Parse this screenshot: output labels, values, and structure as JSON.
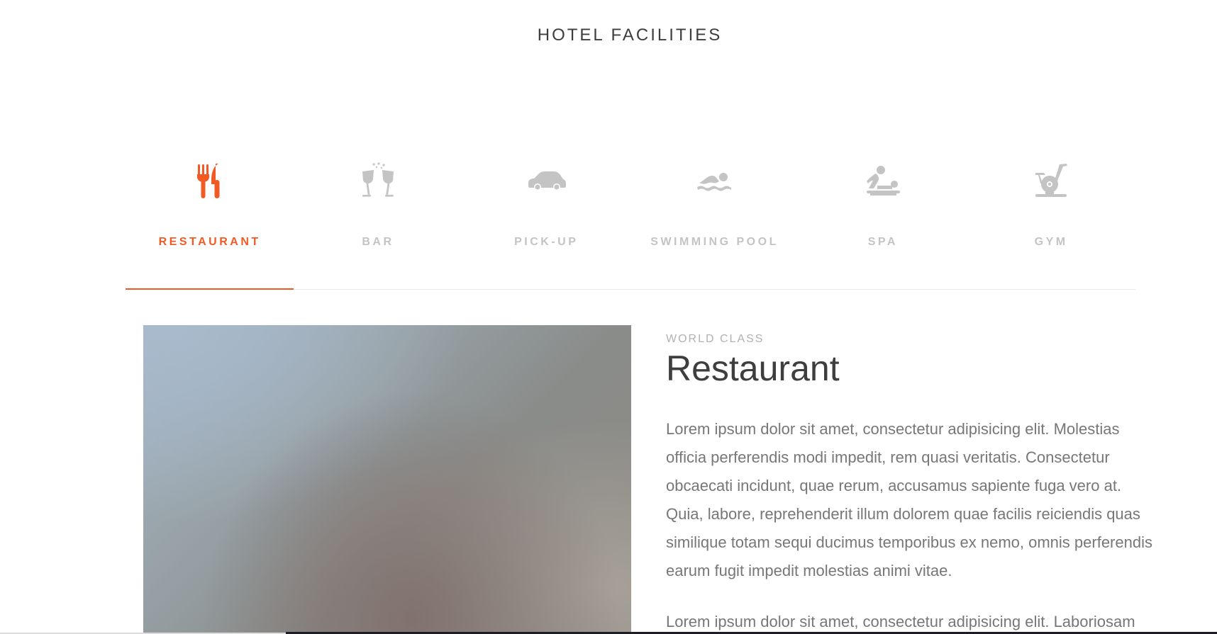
{
  "section": {
    "title": "HOTEL FACILITIES"
  },
  "tabs": [
    {
      "label": "RESTAURANT",
      "icon": "restaurant-icon",
      "active": true
    },
    {
      "label": "BAR",
      "icon": "bar-icon",
      "active": false
    },
    {
      "label": "PICK-UP",
      "icon": "car-icon",
      "active": false
    },
    {
      "label": "SWIMMING POOL",
      "icon": "swimming-pool-icon",
      "active": false
    },
    {
      "label": "SPA",
      "icon": "spa-icon",
      "active": false
    },
    {
      "label": "GYM",
      "icon": "gym-icon",
      "active": false
    }
  ],
  "colors": {
    "accent": "#f15a24",
    "inactive": "#c4c4c4",
    "heading": "#3e3e3e",
    "body_text": "#777777"
  },
  "content": {
    "eyebrow": "WORLD CLASS",
    "heading": "Restaurant",
    "paragraphs": [
      "Lorem ipsum dolor sit amet, consectetur adipisicing elit. Molestias officia perferendis modi impedit, rem quasi veritatis. Consectetur obcaecati incidunt, quae rerum, accusamus sapiente fuga vero at. Quia, labore, reprehenderit illum dolorem quae facilis reiciendis quas similique totam sequi ducimus temporibus ex nemo, omnis perferendis earum fugit impedit molestias animi vitae.",
      "Lorem ipsum dolor sit amet, consectetur adipisicing elit. Laboriosam"
    ]
  }
}
